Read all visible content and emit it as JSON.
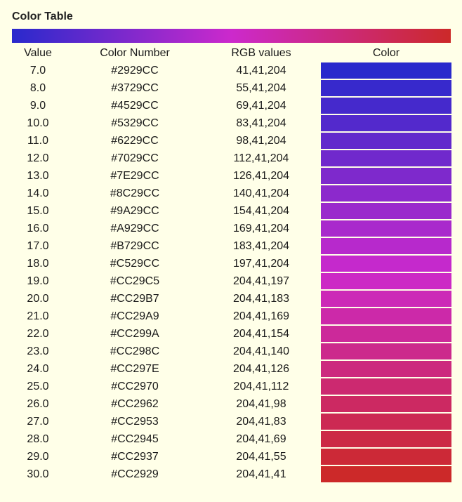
{
  "title": "Color Table",
  "headers": {
    "value": "Value",
    "color_number": "Color Number",
    "rgb": "RGB values",
    "color": "Color"
  },
  "gradient_stops": [
    "#2929CC",
    "#CC29CC",
    "#CC2929"
  ],
  "rows": [
    {
      "value": "7.0",
      "hex": "#2929CC",
      "rgb": "41,41,204"
    },
    {
      "value": "8.0",
      "hex": "#3729CC",
      "rgb": "55,41,204"
    },
    {
      "value": "9.0",
      "hex": "#4529CC",
      "rgb": "69,41,204"
    },
    {
      "value": "10.0",
      "hex": "#5329CC",
      "rgb": "83,41,204"
    },
    {
      "value": "11.0",
      "hex": "#6229CC",
      "rgb": "98,41,204"
    },
    {
      "value": "12.0",
      "hex": "#7029CC",
      "rgb": "112,41,204"
    },
    {
      "value": "13.0",
      "hex": "#7E29CC",
      "rgb": "126,41,204"
    },
    {
      "value": "14.0",
      "hex": "#8C29CC",
      "rgb": "140,41,204"
    },
    {
      "value": "15.0",
      "hex": "#9A29CC",
      "rgb": "154,41,204"
    },
    {
      "value": "16.0",
      "hex": "#A929CC",
      "rgb": "169,41,204"
    },
    {
      "value": "17.0",
      "hex": "#B729CC",
      "rgb": "183,41,204"
    },
    {
      "value": "18.0",
      "hex": "#C529CC",
      "rgb": "197,41,204"
    },
    {
      "value": "19.0",
      "hex": "#CC29C5",
      "rgb": "204,41,197"
    },
    {
      "value": "20.0",
      "hex": "#CC29B7",
      "rgb": "204,41,183"
    },
    {
      "value": "21.0",
      "hex": "#CC29A9",
      "rgb": "204,41,169"
    },
    {
      "value": "22.0",
      "hex": "#CC299A",
      "rgb": "204,41,154"
    },
    {
      "value": "23.0",
      "hex": "#CC298C",
      "rgb": "204,41,140"
    },
    {
      "value": "24.0",
      "hex": "#CC297E",
      "rgb": "204,41,126"
    },
    {
      "value": "25.0",
      "hex": "#CC2970",
      "rgb": "204,41,112"
    },
    {
      "value": "26.0",
      "hex": "#CC2962",
      "rgb": "204,41,98"
    },
    {
      "value": "27.0",
      "hex": "#CC2953",
      "rgb": "204,41,83"
    },
    {
      "value": "28.0",
      "hex": "#CC2945",
      "rgb": "204,41,69"
    },
    {
      "value": "29.0",
      "hex": "#CC2937",
      "rgb": "204,41,55"
    },
    {
      "value": "30.0",
      "hex": "#CC2929",
      "rgb": "204,41,41"
    }
  ]
}
